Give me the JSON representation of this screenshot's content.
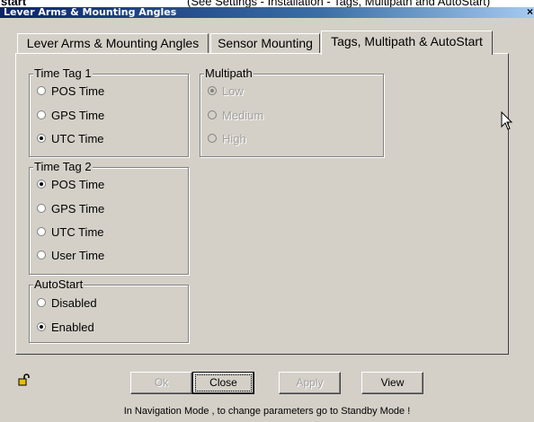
{
  "doc": {
    "left_text": "start",
    "right_text": "(See Settings - Installation - Tags, Multipath and AutoStart)"
  },
  "window": {
    "title": "Lever Arms & Mounting Angles",
    "close_glyph": "×"
  },
  "tabs": [
    {
      "label": "Lever Arms & Mounting Angles",
      "active": false
    },
    {
      "label": "Sensor Mounting",
      "active": false
    },
    {
      "label": "Tags, Multipath & AutoStart",
      "active": true
    }
  ],
  "time_tag_1": {
    "legend": "Time Tag 1",
    "options": [
      "POS Time",
      "GPS Time",
      "UTC Time"
    ],
    "selected": "UTC Time"
  },
  "multipath": {
    "legend": "Multipath",
    "options": [
      "Low",
      "Medium",
      "High"
    ],
    "selected": "Low",
    "enabled": false
  },
  "time_tag_2": {
    "legend": "Time Tag 2",
    "options": [
      "POS Time",
      "GPS Time",
      "UTC Time",
      "User Time"
    ],
    "selected": "POS Time"
  },
  "autostart": {
    "legend": "AutoStart",
    "options": [
      "Disabled",
      "Enabled"
    ],
    "selected": "Enabled"
  },
  "buttons": {
    "ok": "Ok",
    "close": "Close",
    "apply": "Apply",
    "view": "View"
  },
  "status_text": "In Navigation Mode , to change parameters go to Standby Mode !",
  "icons": {
    "lock": "unlocked-padlock-icon",
    "cursor": "mouse-pointer-icon"
  }
}
